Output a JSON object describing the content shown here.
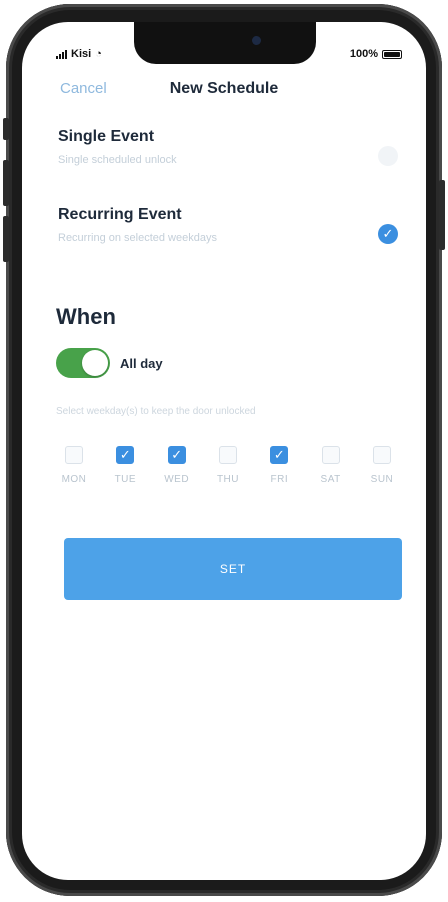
{
  "status_bar": {
    "carrier": "Kisi",
    "battery": "100%"
  },
  "nav": {
    "cancel": "Cancel",
    "title": "New Schedule"
  },
  "options": [
    {
      "title": "Single Event",
      "subtitle": "Single scheduled unlock",
      "selected": false
    },
    {
      "title": "Recurring Event",
      "subtitle": "Recurring on selected weekdays",
      "selected": true
    }
  ],
  "when": {
    "heading": "When",
    "all_day_label": "All day",
    "all_day_on": true,
    "hint": "Select weekday(s) to keep the door unlocked"
  },
  "days": [
    {
      "label": "MON",
      "checked": false
    },
    {
      "label": "TUE",
      "checked": true
    },
    {
      "label": "WED",
      "checked": true
    },
    {
      "label": "THU",
      "checked": false
    },
    {
      "label": "FRI",
      "checked": true
    },
    {
      "label": "SAT",
      "checked": false
    },
    {
      "label": "SUN",
      "checked": false
    }
  ],
  "set_button": "SET",
  "colors": {
    "accent": "#3b8fe0",
    "toggle_on": "#48a24a",
    "button": "#4da2e8",
    "muted_text": "#c4cfd9"
  }
}
